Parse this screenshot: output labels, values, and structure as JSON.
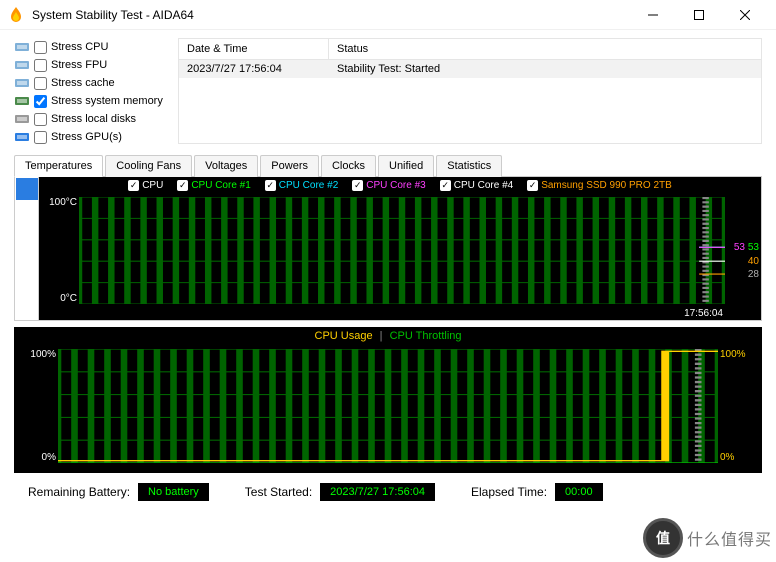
{
  "window": {
    "title": "System Stability Test - AIDA64"
  },
  "stress": {
    "items": [
      {
        "label": "Stress CPU",
        "checked": false
      },
      {
        "label": "Stress FPU",
        "checked": false
      },
      {
        "label": "Stress cache",
        "checked": false
      },
      {
        "label": "Stress system memory",
        "checked": true
      },
      {
        "label": "Stress local disks",
        "checked": false
      },
      {
        "label": "Stress GPU(s)",
        "checked": false
      }
    ]
  },
  "log": {
    "headers": {
      "datetime": "Date & Time",
      "status": "Status"
    },
    "rows": [
      {
        "datetime": "2023/7/27 17:56:04",
        "status": "Stability Test: Started"
      }
    ]
  },
  "tabs": [
    "Temperatures",
    "Cooling Fans",
    "Voltages",
    "Powers",
    "Clocks",
    "Unified",
    "Statistics"
  ],
  "active_tab": 0,
  "chart_data": {
    "temp_chart": {
      "type": "line",
      "y_top": "100°C",
      "y_bottom": "0°C",
      "x_label": "17:56:04",
      "series": [
        {
          "name": "CPU",
          "color": "#ffffff",
          "last": 53
        },
        {
          "name": "CPU Core #1",
          "color": "#00ff00",
          "last": 53
        },
        {
          "name": "CPU Core #2",
          "color": "#00e0ff",
          "last": 53
        },
        {
          "name": "CPU Core #3",
          "color": "#ff40ff",
          "last": 53
        },
        {
          "name": "CPU Core #4",
          "color": "#ffffff",
          "last": 40
        },
        {
          "name": "Samsung SSD 990 PRO 2TB",
          "color": "#ffa000",
          "last": 28
        }
      ],
      "right_labels": [
        {
          "text": "53",
          "color": "#00ff00",
          "pos": 47
        },
        {
          "text": "53",
          "color": "#ff40ff",
          "pos": 47,
          "offset": 14
        },
        {
          "text": "40",
          "color": "#ffa000",
          "pos": 60
        },
        {
          "text": "28",
          "color": "#b0b0b0",
          "pos": 72
        }
      ]
    },
    "usage_chart": {
      "type": "line",
      "legend": {
        "usage": "CPU Usage",
        "sep": "|",
        "throttling": "CPU Throttling"
      },
      "y_top": "100%",
      "y_bottom": "0%",
      "right_top": "100%",
      "right_bottom": "0%",
      "series": [
        {
          "name": "CPU Usage",
          "color": "#ffd000",
          "profile": "step_to_100_near_end"
        },
        {
          "name": "CPU Throttling",
          "color": "#00c000",
          "profile": "zero"
        }
      ]
    }
  },
  "status": {
    "battery_label": "Remaining Battery:",
    "battery_value": "No battery",
    "started_label": "Test Started:",
    "started_value": "2023/7/27 17:56:04",
    "elapsed_label": "Elapsed Time:",
    "elapsed_value": "00:00"
  },
  "watermark": {
    "badge": "值",
    "text": "什么值得买"
  }
}
